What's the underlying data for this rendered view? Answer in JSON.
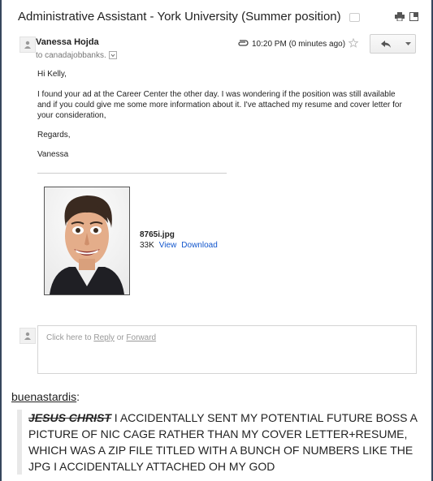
{
  "email": {
    "subject": "Administrative Assistant - York University (Summer position)",
    "sender": "Vanessa Hojda",
    "to": "to canadajobbanks.",
    "time": "10:20 PM (0 minutes ago)",
    "greeting": "Hi Kelly,",
    "body": "I found your ad at the Career Center the other day. I was wondering if the position was still available and if you could give me some more information about it. I've attached my resume and cover letter for your consideration,",
    "signoff": "Regards,",
    "signature": "Vanessa",
    "attachment": {
      "filename": "8765i.jpg",
      "size": "33K",
      "view_label": "View",
      "download_label": "Download"
    },
    "reply_prompt": {
      "prefix": "Click here to",
      "reply_label": "Reply",
      "or": "or",
      "forward_label": "Forward"
    }
  },
  "post": {
    "username": "buenastardis",
    "colon": ":",
    "strike_text": "JESUS CHRIST",
    "text": " I ACCIDENTALLY SENT MY POTENTIAL FUTURE BOSS A PICTURE OF NIC CAGE RATHER THAN MY COVER LETTER+RESUME, WHICH WAS A ZIP FILE TITLED WITH A BUNCH OF NUMBERS LIKE THE JPG I ACCIDENTALLY ATTACHED OH MY GOD"
  },
  "icons": {
    "label": "label-tag-icon",
    "print": "print-icon",
    "new_window": "new-window-icon",
    "attachment": "paperclip-icon",
    "star": "star-icon",
    "reply": "reply-arrow-icon",
    "more": "chevron-down-icon",
    "avatar": "person-icon"
  },
  "colors": {
    "background": "#36465d",
    "link": "#1155cc"
  }
}
